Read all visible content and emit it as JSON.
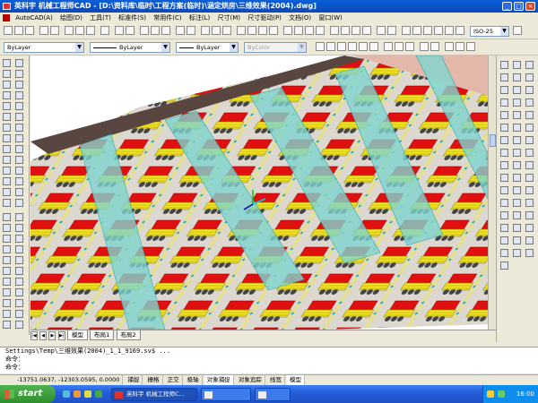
{
  "window": {
    "title": "英科宇 机械工程师CAD - [D:\\资料库\\临时\\工程方案(临时)\\涵定烘房\\三维效果(2004).dwg]"
  },
  "menu": [
    "AutoCAD(A)",
    "绘图(D)",
    "工具(T)",
    "标准件(S)",
    "常用件(C)",
    "标注(L)",
    "尺寸(M)",
    "尺寸驱动(P)",
    "文档(O)",
    "窗口(W)"
  ],
  "toolbar": {
    "dimstyle": "ISO-25",
    "layer": "ByLayer",
    "linetype": "ByLayer",
    "lineweight": "ByLayer",
    "plotstyle": "ByColor"
  },
  "tabs": {
    "items": [
      "模型",
      "布局1",
      "布局2"
    ],
    "active": 0
  },
  "command": {
    "history": "Settings\\Temp\\三维效果(2004)_1_1_9169.sv$ ...",
    "prompt1": "命令：",
    "prompt2": "命令："
  },
  "status": {
    "coords": "-13751.0637, -12303.0595, 0.0000",
    "buttons": [
      {
        "label": "捕捉",
        "on": false
      },
      {
        "label": "栅格",
        "on": false
      },
      {
        "label": "正交",
        "on": false
      },
      {
        "label": "极轴",
        "on": false
      },
      {
        "label": "对象捕捉",
        "on": true
      },
      {
        "label": "对象追踪",
        "on": false
      },
      {
        "label": "线宽",
        "on": false
      },
      {
        "label": "模型",
        "on": true
      }
    ]
  },
  "taskbar": {
    "start": "start",
    "tasks": [
      "英科宇 机械工程师C...",
      "",
      ""
    ],
    "clock": "16:00"
  },
  "colors": {
    "titlebar": "#0c49b7",
    "machine_red": "#e01010",
    "machine_yellow": "#f0e020",
    "duct_cyan": "#7fd4d0",
    "floor_pink": "#e3b7aa"
  }
}
